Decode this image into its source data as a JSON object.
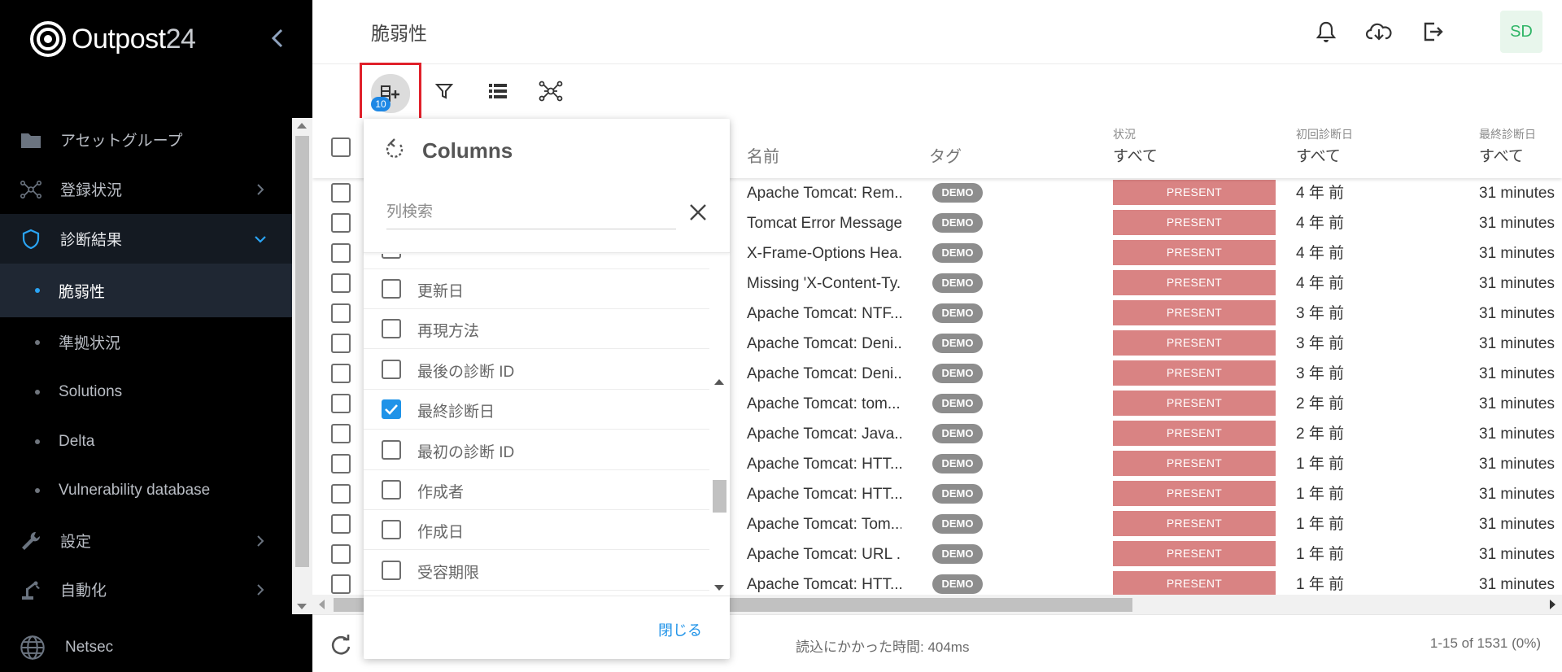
{
  "brand": {
    "name": "Outpost",
    "number": "24"
  },
  "colors": {
    "accent": "#1f93e8",
    "status_present": "#d98383",
    "tag": "#8d8d8d",
    "highlight": "#e0202a"
  },
  "sidebar": {
    "items": [
      {
        "label": "アセットグループ",
        "icon": "folder-icon"
      },
      {
        "label": "登録状況",
        "icon": "network-icon"
      },
      {
        "label": "診断結果",
        "icon": "shield-icon"
      },
      {
        "label": "脆弱性"
      },
      {
        "label": "準拠状況"
      },
      {
        "label": "Solutions"
      },
      {
        "label": "Delta"
      },
      {
        "label": "Vulnerability database"
      },
      {
        "label": "設定",
        "icon": "wrench-icon"
      },
      {
        "label": "自動化",
        "icon": "robot-arm-icon"
      },
      {
        "label": "Netsec",
        "icon": "globe-icon"
      }
    ]
  },
  "header": {
    "title": "脆弱性",
    "avatar": "SD"
  },
  "toolbar": {
    "columns_count": "10"
  },
  "table": {
    "headers": {
      "name": "名前",
      "tag": "タグ",
      "status_label": "状況",
      "status_filter": "すべて",
      "first_scan_label": "初回診断日",
      "first_scan_filter": "すべて",
      "last_scan_label": "最終診断日",
      "last_scan_filter": "すべて"
    },
    "rows": [
      {
        "name": "Apache Tomcat: Rem...",
        "tag": "DEMO",
        "status": "PRESENT",
        "first": "4 年 前",
        "last": "31 minutes"
      },
      {
        "name": "Tomcat Error Message",
        "tag": "DEMO",
        "status": "PRESENT",
        "first": "4 年 前",
        "last": "31 minutes"
      },
      {
        "name": "X-Frame-Options Hea...",
        "tag": "DEMO",
        "status": "PRESENT",
        "first": "4 年 前",
        "last": "31 minutes"
      },
      {
        "name": "Missing 'X-Content-Ty...",
        "tag": "DEMO",
        "status": "PRESENT",
        "first": "4 年 前",
        "last": "31 minutes"
      },
      {
        "name": "Apache Tomcat: NTF...",
        "tag": "DEMO",
        "status": "PRESENT",
        "first": "3 年 前",
        "last": "31 minutes"
      },
      {
        "name": "Apache Tomcat: Deni...",
        "tag": "DEMO",
        "status": "PRESENT",
        "first": "3 年 前",
        "last": "31 minutes"
      },
      {
        "name": "Apache Tomcat: Deni...",
        "tag": "DEMO",
        "status": "PRESENT",
        "first": "3 年 前",
        "last": "31 minutes"
      },
      {
        "name": "Apache Tomcat: tom...",
        "tag": "DEMO",
        "status": "PRESENT",
        "first": "2 年 前",
        "last": "31 minutes"
      },
      {
        "name": "Apache Tomcat: Java...",
        "tag": "DEMO",
        "status": "PRESENT",
        "first": "2 年 前",
        "last": "31 minutes"
      },
      {
        "name": "Apache Tomcat: HTT...",
        "tag": "DEMO",
        "status": "PRESENT",
        "first": "1 年 前",
        "last": "31 minutes"
      },
      {
        "name": "Apache Tomcat: HTT...",
        "tag": "DEMO",
        "status": "PRESENT",
        "first": "1 年 前",
        "last": "31 minutes"
      },
      {
        "name": "Apache Tomcat: Tom...",
        "tag": "DEMO",
        "status": "PRESENT",
        "first": "1 年 前",
        "last": "31 minutes"
      },
      {
        "name": "Apache Tomcat: URL ...",
        "tag": "DEMO",
        "status": "PRESENT",
        "first": "1 年 前",
        "last": "31 minutes"
      },
      {
        "name": "Apache Tomcat: HTT...",
        "tag": "DEMO",
        "status": "PRESENT",
        "first": "1 年 前",
        "last": "31 minutes"
      }
    ]
  },
  "footer": {
    "load_time": "読込にかかった時間: 404ms",
    "paging": "1-15 of 1531 (0%)"
  },
  "columns_popup": {
    "title": "Columns",
    "search_placeholder": "列検索",
    "items": [
      {
        "label": "更新日",
        "checked": false
      },
      {
        "label": "再現方法",
        "checked": false
      },
      {
        "label": "最後の診断 ID",
        "checked": false
      },
      {
        "label": "最終診断日",
        "checked": true
      },
      {
        "label": "最初の診断 ID",
        "checked": false
      },
      {
        "label": "作成者",
        "checked": false
      },
      {
        "label": "作成日",
        "checked": false
      },
      {
        "label": "受容期限",
        "checked": false
      }
    ],
    "close_label": "閉じる"
  }
}
